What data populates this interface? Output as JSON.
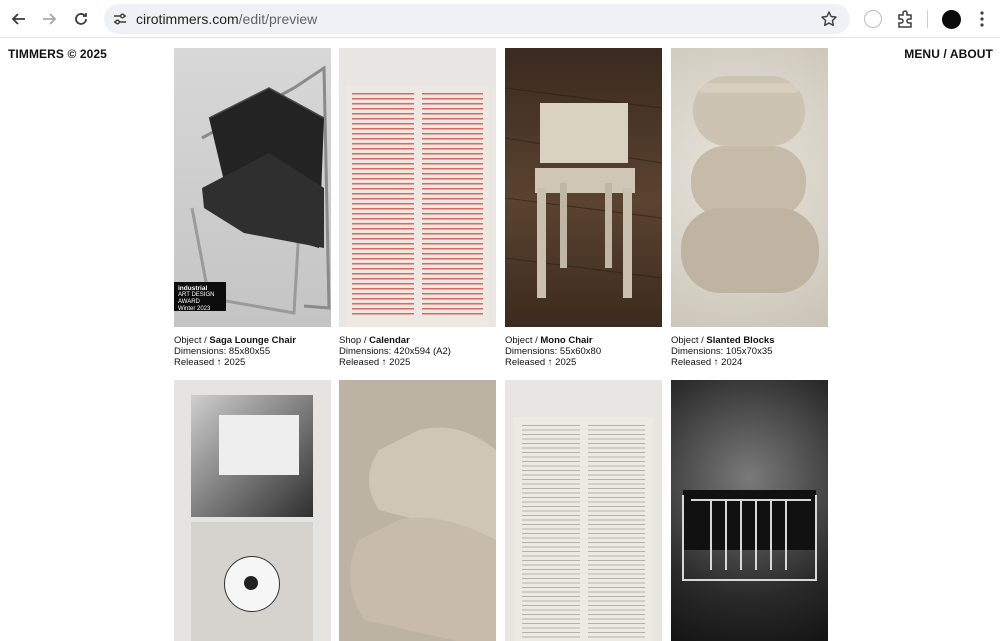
{
  "browser": {
    "url_host": "cirotimmers.com",
    "url_path": "/edit/preview"
  },
  "site": {
    "title": "TIMMERS © 2025",
    "menu": "MENU / ABOUT"
  },
  "products": [
    {
      "category": "Object / ",
      "name": "Saga Lounge Chair",
      "dimensions": "Dimensions: 85x80x55",
      "released": "Released ↑ 2025",
      "thumb": "chair-black"
    },
    {
      "category": "Shop / ",
      "name": "Calendar",
      "dimensions": "Dimensions: 420x594 (A2)",
      "released": "Released ↑ 2025",
      "thumb": "calendar-red"
    },
    {
      "category": "Object / ",
      "name": "Mono Chair",
      "dimensions": "Dimensions: 55x60x80",
      "released": "Released ↑ 2025",
      "thumb": "chair-cream"
    },
    {
      "category": "Object / ",
      "name": "Slanted Blocks",
      "dimensions": "Dimensions: 105x70x35",
      "released": "Released ↑ 2024",
      "thumb": "blocks"
    }
  ],
  "badge": {
    "line1": "industrial",
    "line2": "ART DESIGN AWARD",
    "line3": "Winter 2023"
  },
  "row2": [
    {
      "thumb": "photo-room"
    },
    {
      "thumb": "blocks-closeup"
    },
    {
      "thumb": "calendar-lines"
    },
    {
      "thumb": "chrome-chair"
    }
  ]
}
